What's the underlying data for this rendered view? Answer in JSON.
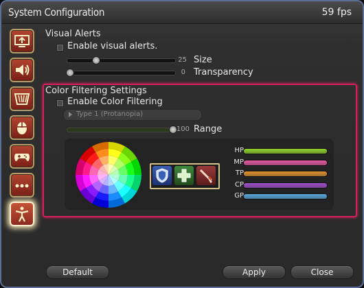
{
  "window": {
    "title": "System Configuration",
    "fps": "59 fps"
  },
  "nav": {
    "items": [
      {
        "name": "display-settings-icon"
      },
      {
        "name": "sound-settings-icon"
      },
      {
        "name": "theme-settings-icon"
      },
      {
        "name": "mouse-settings-icon"
      },
      {
        "name": "gamepad-settings-icon"
      },
      {
        "name": "other-settings-icon"
      },
      {
        "name": "accessibility-settings-icon",
        "active": true
      }
    ]
  },
  "visual_alerts": {
    "heading": "Visual Alerts",
    "checkbox_label": "Enable visual alerts.",
    "size": {
      "label": "Size",
      "value": "25",
      "fraction": 0.25
    },
    "transparency": {
      "label": "Transparency",
      "value": "0",
      "fraction": 0.0
    }
  },
  "color_filtering": {
    "heading": "Color Filtering Settings",
    "checkbox_label": "Enable Color Filtering",
    "filter_type": "Type 1 (Protanopia)",
    "range": {
      "label": "Range",
      "value": "100",
      "fraction": 1.0
    },
    "bars": [
      {
        "label": "HP",
        "color": "#8fd12a"
      },
      {
        "label": "MP",
        "color": "#e15a9f"
      },
      {
        "label": "TP",
        "color": "#e0932f"
      },
      {
        "label": "CP",
        "color": "#a050c8"
      },
      {
        "label": "GP",
        "color": "#5aa6d8"
      }
    ],
    "jobs": [
      "tank-role-icon",
      "healer-role-icon",
      "dps-role-icon"
    ]
  },
  "buttons": {
    "default": "Default",
    "apply": "Apply",
    "close": "Close"
  },
  "colors": {
    "highlight": "#d61f5f",
    "frame": "#5b6f99"
  }
}
